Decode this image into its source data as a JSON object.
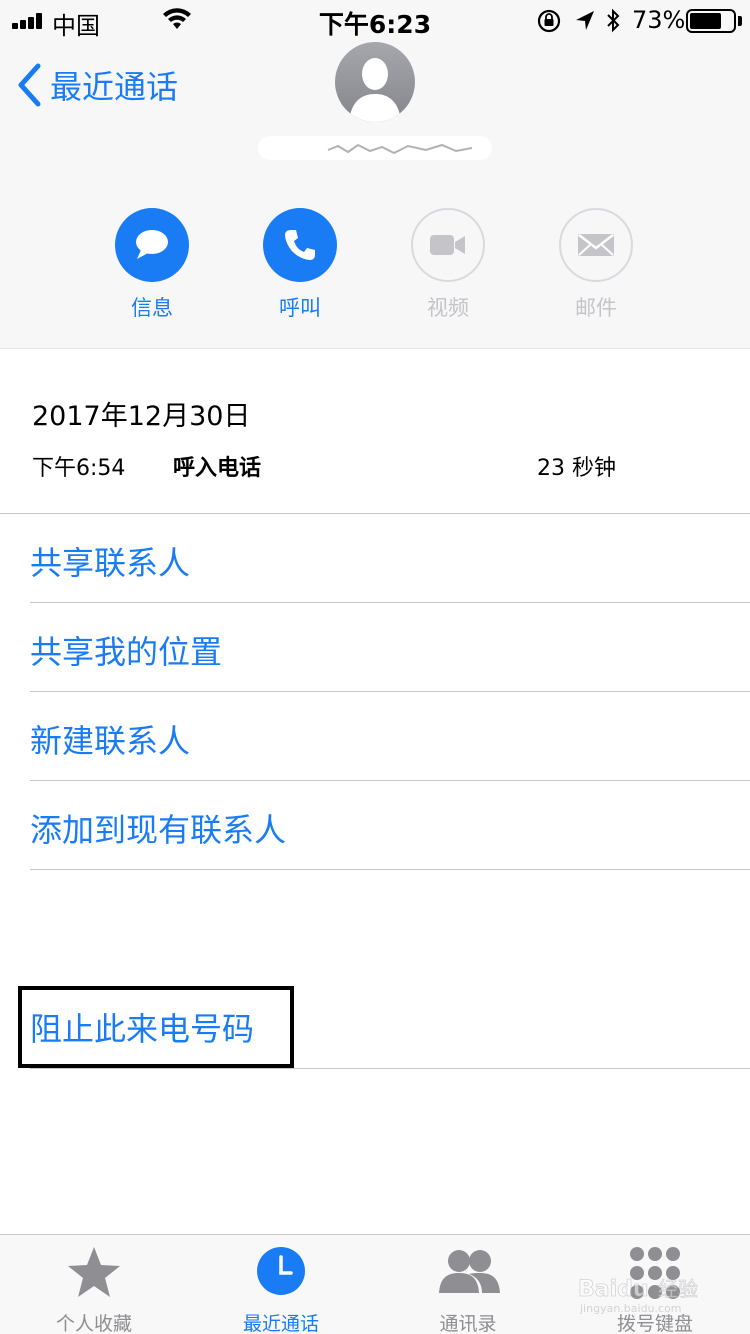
{
  "status_bar": {
    "carrier": "中国",
    "time": "下午6:23",
    "battery": "73%",
    "battery_level": 0.73
  },
  "nav": {
    "back_label": "最近通话"
  },
  "actions": [
    {
      "label": "信息",
      "icon": "message-icon",
      "enabled": true
    },
    {
      "label": "呼叫",
      "icon": "phone-icon",
      "enabled": true
    },
    {
      "label": "视频",
      "icon": "video-icon",
      "enabled": false
    },
    {
      "label": "邮件",
      "icon": "mail-icon",
      "enabled": false
    }
  ],
  "call_info": {
    "date": "2017年12月30日",
    "time": "下午6:54",
    "type": "呼入电话",
    "duration": "23 秒钟"
  },
  "menu": {
    "share_contact": "共享联系人",
    "share_location": "共享我的位置",
    "new_contact": "新建联系人",
    "add_to_existing": "添加到现有联系人",
    "block_caller": "阻止此来电号码"
  },
  "tabbar": [
    {
      "label": "个人收藏",
      "icon": "star-icon",
      "active": false
    },
    {
      "label": "最近通话",
      "icon": "clock-icon",
      "active": true
    },
    {
      "label": "通讯录",
      "icon": "contacts-icon",
      "active": false
    },
    {
      "label": "拨号键盘",
      "icon": "keypad-icon",
      "active": false
    }
  ],
  "colors": {
    "accent": "#1a7cf5",
    "inactive": "#c4c4c9",
    "header_bg": "#f7f7f8"
  }
}
